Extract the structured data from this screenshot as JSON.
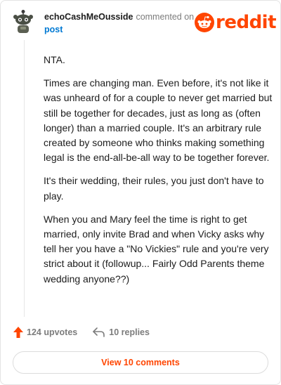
{
  "header": {
    "username": "echoCashMeOusside",
    "action_text": "commented on",
    "post_link": "post",
    "logo_text": "reddit"
  },
  "comment": {
    "paragraphs": [
      "NTA.",
      "Times are changing man. Even before, it's not like it was unheard of for a couple to never get married but still be together for decades, just as long as (often longer) than a married couple. It's an arbitrary rule created by someone who thinks making something legal is the end-all-be-all way to be together forever.",
      "It's their wedding, their rules, you just don't have to play.",
      "When you and Mary feel the time is right to get married, only invite Brad and when Vicky asks why tell her you have a \"No Vickies\" rule and you're very strict about it (followup... Fairly Odd Parents theme wedding anyone??)"
    ]
  },
  "actions": {
    "upvotes_label": "124 upvotes",
    "replies_label": "10 replies",
    "view_comments_label": "View 10 comments"
  },
  "colors": {
    "brand": "#ff4500",
    "link": "#0079d3",
    "muted": "#7c7c7c"
  },
  "icons": {
    "avatar": "snoo-avatar-icon",
    "logo": "reddit-snoo-icon",
    "upvote": "upvote-arrow-icon",
    "reply": "reply-arrow-icon"
  }
}
